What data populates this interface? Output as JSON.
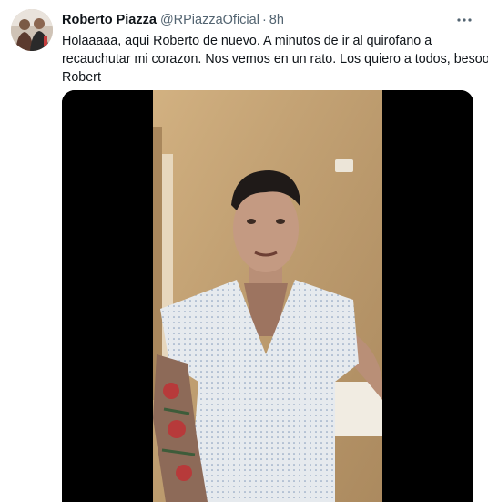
{
  "tweet": {
    "author": {
      "display_name": "Roberto Piazza",
      "handle": "@RPiazzaOficial",
      "avatar_icon": "profile-photo"
    },
    "separator": "·",
    "time": "8h",
    "more_icon": "more-horizontal-icon",
    "text_lines": [
      "Holaaaaa, aqui Roberto de nuevo. A minutos de ir al quirofano a",
      "recauchutar mi corazon. Nos vemos en un rato. Los quiero a todos, besooo.",
      "Robert"
    ],
    "media": {
      "type": "video",
      "description_icon": "video-thumbnail"
    }
  },
  "colors": {
    "text": "#0f1419",
    "secondary": "#536471",
    "wall": "#c9a574",
    "gown": "#e6eaee"
  }
}
